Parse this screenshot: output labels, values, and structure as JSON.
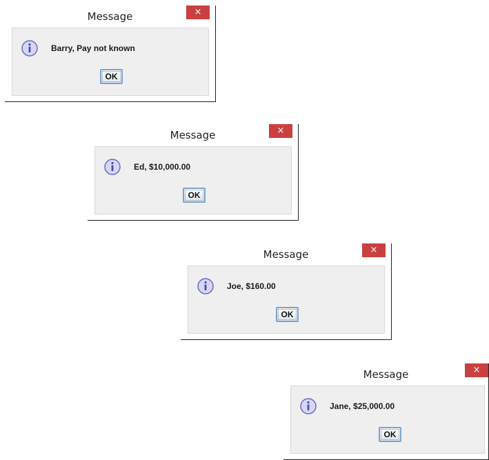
{
  "dialogs": [
    {
      "title": "Message",
      "close_symbol": "×",
      "icon": "info-icon",
      "message": "Barry, Pay not known",
      "ok_label": "OK"
    },
    {
      "title": "Message",
      "close_symbol": "×",
      "icon": "info-icon",
      "message": "Ed, $10,000.00",
      "ok_label": "OK"
    },
    {
      "title": "Message",
      "close_symbol": "×",
      "icon": "info-icon",
      "message": "Joe, $160.00",
      "ok_label": "OK"
    },
    {
      "title": "Message",
      "close_symbol": "×",
      "icon": "info-icon",
      "message": "Jane, $25,000.00",
      "ok_label": "OK"
    }
  ],
  "colors": {
    "close_button": "#c9403f",
    "content_bg": "#efefef",
    "ok_border": "#7da2ce",
    "info_icon_fill": "#d6d6f5",
    "info_icon_stroke": "#6a68c8"
  }
}
